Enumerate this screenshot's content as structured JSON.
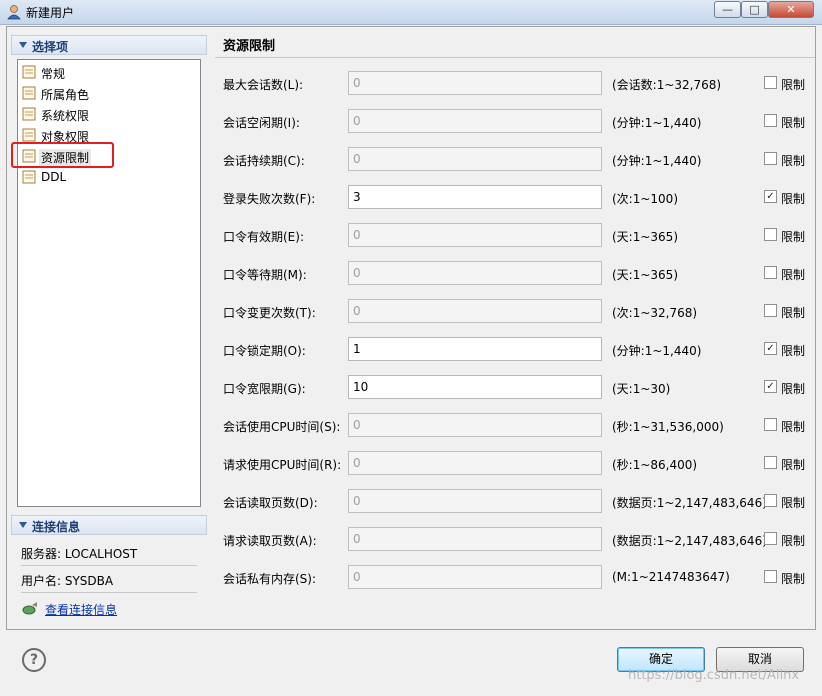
{
  "window": {
    "title": "新建用户",
    "minimize": "—",
    "maximize": "□",
    "close": "✕"
  },
  "sidebar": {
    "section_title": "选择项",
    "items": [
      {
        "label": "常规"
      },
      {
        "label": "所属角色"
      },
      {
        "label": "系统权限"
      },
      {
        "label": "对象权限"
      },
      {
        "label": "资源限制"
      },
      {
        "label": "DDL"
      }
    ],
    "selected_index": 4
  },
  "connection": {
    "section_title": "连接信息",
    "server": "服务器: LOCALHOST",
    "user": "用户名: SYSDBA",
    "view_link": "查看连接信息"
  },
  "main": {
    "title": "资源限制",
    "limit_label": "限制",
    "rows": [
      {
        "label": "最大会话数(L):",
        "value": "0",
        "range": "(会话数:1~32,768)",
        "checked": false
      },
      {
        "label": "会话空闲期(I):",
        "value": "0",
        "range": "(分钟:1~1,440)",
        "checked": false
      },
      {
        "label": "会话持续期(C):",
        "value": "0",
        "range": "(分钟:1~1,440)",
        "checked": false
      },
      {
        "label": "登录失败次数(F):",
        "value": "3",
        "range": "(次:1~100)",
        "checked": true
      },
      {
        "label": "口令有效期(E):",
        "value": "0",
        "range": "(天:1~365)",
        "checked": false
      },
      {
        "label": "口令等待期(M):",
        "value": "0",
        "range": "(天:1~365)",
        "checked": false
      },
      {
        "label": "口令变更次数(T):",
        "value": "0",
        "range": "(次:1~32,768)",
        "checked": false
      },
      {
        "label": "口令锁定期(O):",
        "value": "1",
        "range": "(分钟:1~1,440)",
        "checked": true
      },
      {
        "label": "口令宽限期(G):",
        "value": "10",
        "range": "(天:1~30)",
        "checked": true
      },
      {
        "label": "会话使用CPU时间(S):",
        "value": "0",
        "range": "(秒:1~31,536,000)",
        "checked": false
      },
      {
        "label": "请求使用CPU时间(R):",
        "value": "0",
        "range": "(秒:1~86,400)",
        "checked": false
      },
      {
        "label": "会话读取页数(D):",
        "value": "0",
        "range": "(数据页:1~2,147,483,646)",
        "checked": false
      },
      {
        "label": "请求读取页数(A):",
        "value": "0",
        "range": "(数据页:1~2,147,483,646)",
        "checked": false
      },
      {
        "label": "会话私有内存(S):",
        "value": "0",
        "range": "(M:1~2147483647)",
        "checked": false
      }
    ]
  },
  "footer": {
    "help": "?",
    "ok_label": "确定",
    "cancel_label": "取消"
  },
  "watermark": "https://blog.csdn.net/Allnx"
}
